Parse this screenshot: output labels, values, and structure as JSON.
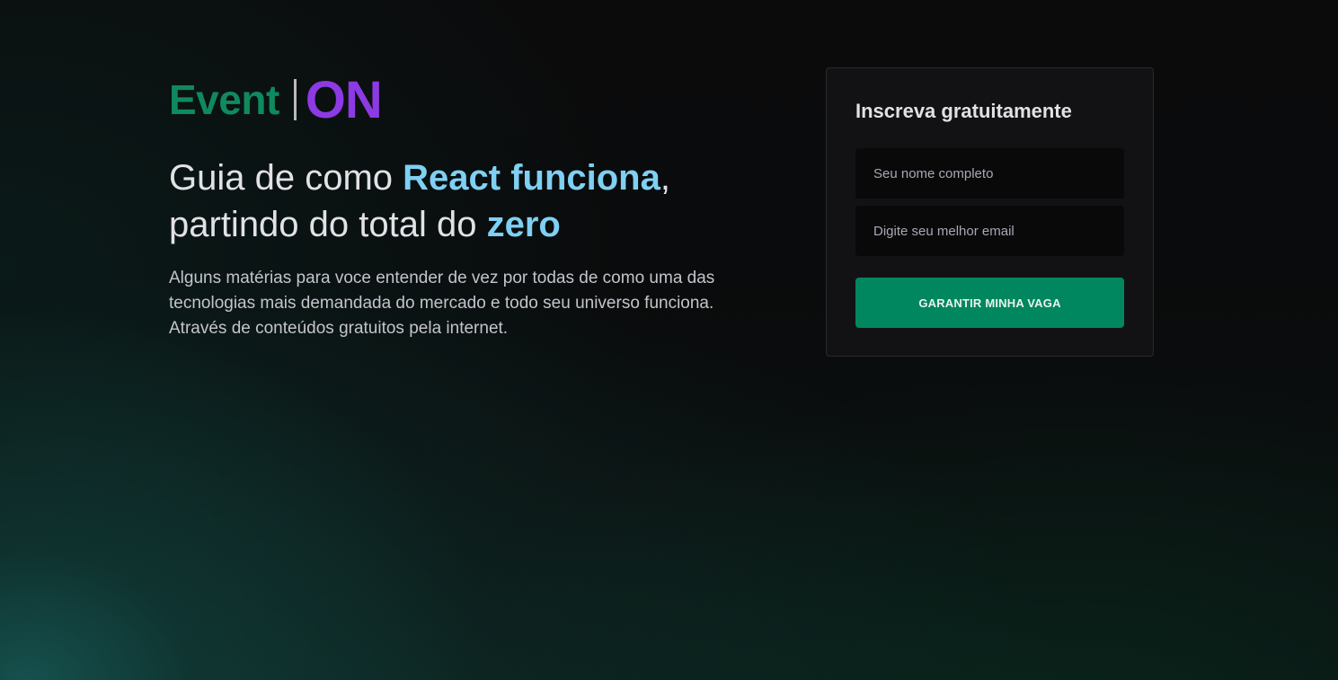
{
  "brand": {
    "part1": "Event",
    "part2": "ON",
    "colors": {
      "event": "#0f8a5e",
      "on": "#8c3ae3",
      "divider": "#b9b9bd"
    }
  },
  "hero": {
    "headline": {
      "pre1": "Guia de como ",
      "highlight1": "React funciona",
      "post1": ",",
      "pre2": "partindo do total do ",
      "highlight2": "zero"
    },
    "description": "Alguns matérias para voce entender de vez por todas de como uma das tecnologias mais demandada do mercado e todo seu universo funciona. Através de conteúdos gratuitos pela internet.",
    "highlight_color": "#7fd0f2"
  },
  "signup": {
    "title": "Inscreva gratuitamente",
    "name_field": {
      "placeholder": "Seu nome completo",
      "value": ""
    },
    "email_field": {
      "placeholder": "Digite seu melhor email",
      "value": ""
    },
    "submit_label": "GARANTIR MINHA VAGA",
    "button_color": "#00875f"
  }
}
